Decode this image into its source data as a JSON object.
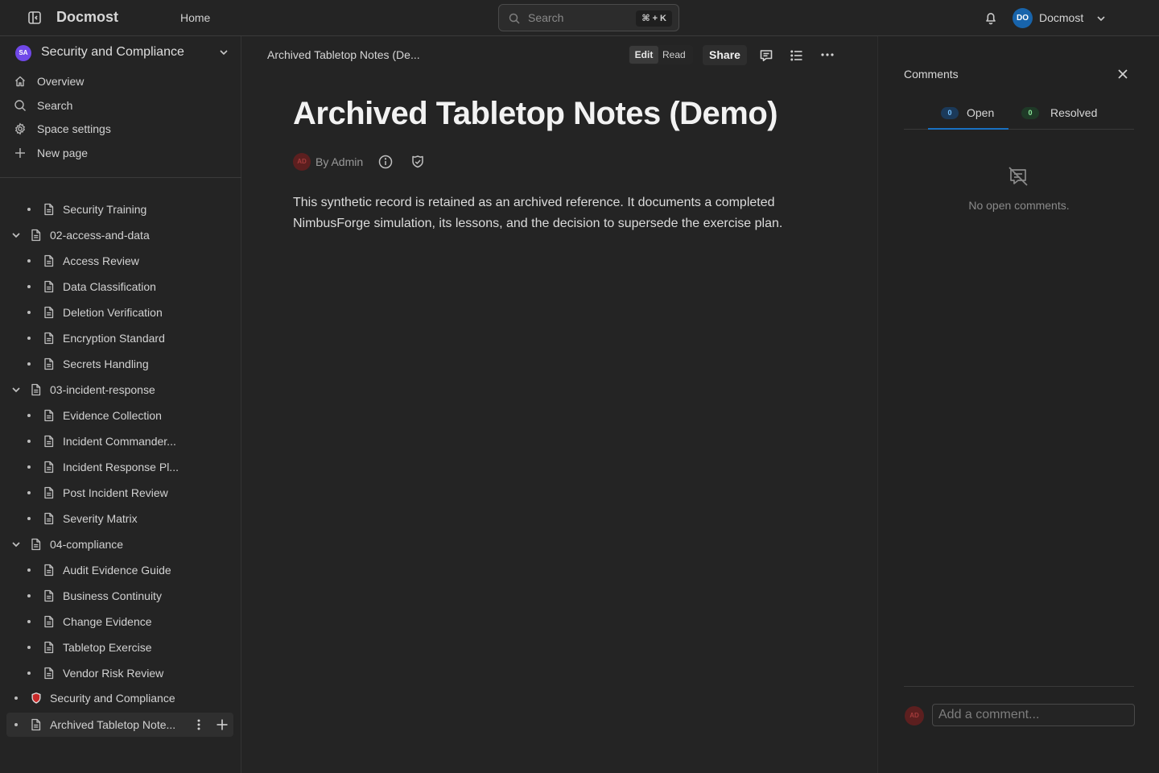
{
  "header": {
    "brand": "Docmost",
    "home": "Home",
    "search_label": "Search",
    "search_shortcut": "⌘ + K",
    "user_initials": "DO",
    "user_name": "Docmost"
  },
  "sidebar": {
    "space_initials": "SA",
    "space_name": "Security and Compliance",
    "nav": [
      {
        "label": "Overview",
        "icon": "home-icon"
      },
      {
        "label": "Search",
        "icon": "search-icon"
      },
      {
        "label": "Space settings",
        "icon": "gear-icon"
      },
      {
        "label": "New page",
        "icon": "plus-icon"
      }
    ],
    "tree": [
      {
        "label": "Security Training",
        "level": 2
      },
      {
        "label": "02-access-and-data",
        "level": 1,
        "expanded": true
      },
      {
        "label": "Access Review",
        "level": 2
      },
      {
        "label": "Data Classification",
        "level": 2
      },
      {
        "label": "Deletion Verification",
        "level": 2
      },
      {
        "label": "Encryption Standard",
        "level": 2
      },
      {
        "label": "Secrets Handling",
        "level": 2
      },
      {
        "label": "03-incident-response",
        "level": 1,
        "expanded": true
      },
      {
        "label": "Evidence Collection",
        "level": 2
      },
      {
        "label": "Incident Commander...",
        "level": 2
      },
      {
        "label": "Incident Response Pl...",
        "level": 2
      },
      {
        "label": "Post Incident Review",
        "level": 2
      },
      {
        "label": "Severity Matrix",
        "level": 2
      },
      {
        "label": "04-compliance",
        "level": 1,
        "expanded": true
      },
      {
        "label": "Audit Evidence Guide",
        "level": 2
      },
      {
        "label": "Business Continuity",
        "level": 2
      },
      {
        "label": "Change Evidence",
        "level": 2
      },
      {
        "label": "Tabletop Exercise",
        "level": 2
      },
      {
        "label": "Vendor Risk Review",
        "level": 2
      },
      {
        "label": "Security and Compliance",
        "level": 1,
        "icon": "shield-emoji-icon"
      },
      {
        "label": "Archived Tabletop Note...",
        "level": 1,
        "active": true
      }
    ]
  },
  "page": {
    "breadcrumb": "Archived Tabletop Notes (De...",
    "mode_edit": "Edit",
    "mode_read": "Read",
    "mode_selected": "Edit",
    "share": "Share",
    "title": "Archived Tabletop Notes (Demo)",
    "author_initials": "AD",
    "author": "By Admin",
    "body": "This synthetic record is retained as an archived reference. It documents a completed NimbusForge simulation, its lessons, and the decision to supersede the exercise plan."
  },
  "comments": {
    "title": "Comments",
    "tabs": [
      {
        "label": "Open",
        "count": "0"
      },
      {
        "label": "Resolved",
        "count": "0"
      }
    ],
    "active_tab": "Open",
    "empty": "No open comments.",
    "avatar_initials": "AD",
    "placeholder": "Add a comment..."
  },
  "colors": {
    "background": "#242424",
    "accent": "#1971c2",
    "user_avatar": "#1864ab",
    "space_avatar": "#7048e8",
    "author_avatar": "#5c1f1f"
  }
}
